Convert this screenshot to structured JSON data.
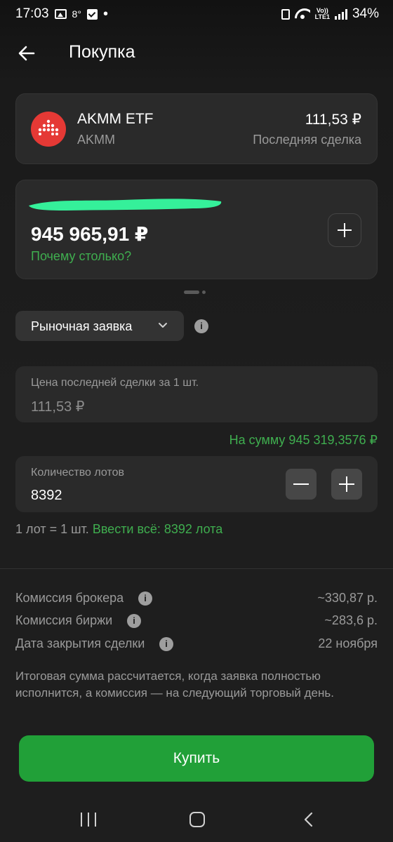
{
  "status_bar": {
    "time": "17:03",
    "temperature": "8°",
    "battery": "34%",
    "network_top": "Vo))",
    "network_bottom": "LTE1"
  },
  "header": {
    "title": "Покупка"
  },
  "instrument": {
    "name": "AKMM ETF",
    "ticker": "AKMM",
    "price": "111,53 ₽",
    "price_label": "Последняя сделка"
  },
  "balance": {
    "amount": "945 965,91 ₽",
    "why_link": "Почему столько?"
  },
  "order": {
    "type_label": "Рыночная заявка",
    "price_label": "Цена последней сделки за 1 шт.",
    "price_value": "111,53 ₽",
    "sum_text": "На сумму 945 319,3576 ₽",
    "qty_label": "Количество лотов",
    "qty_value": "8392",
    "lot_info": "1 лот = 1 шт.",
    "enter_all": "Ввести всё: 8392 лота"
  },
  "fees": [
    {
      "label": "Комиссия брокера",
      "value": "~330,87 р."
    },
    {
      "label": "Комиссия биржи",
      "value": "~283,6 р."
    },
    {
      "label": "Дата закрытия сделки",
      "value": "22 ноября"
    }
  ],
  "note": "Итоговая сумма рассчитается, когда заявка полностью исполнится, а комиссия — на следующий торговый день.",
  "buy_button": "Купить",
  "colors": {
    "accent_green": "#21a038",
    "link_green": "#3fae4f",
    "logo_red": "#e53935",
    "redaction": "#35f09a"
  }
}
